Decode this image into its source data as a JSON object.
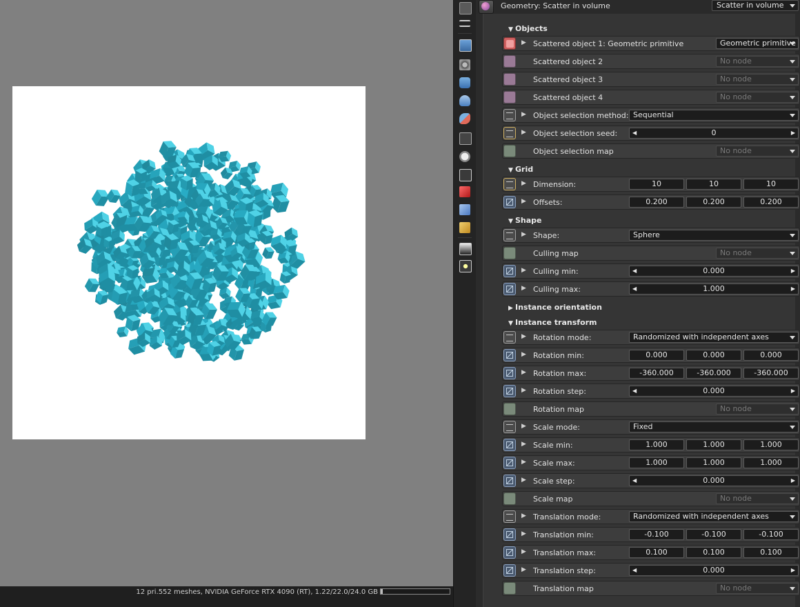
{
  "viewport": {
    "status": "12 pri.552 meshes, NVIDIA GeForce RTX 4090 (RT), 1.22/22.0/24.0 GB",
    "memory_fraction": 0.03,
    "render_background": "#ffffff",
    "cube_color": "#2ab5cf"
  },
  "panel": {
    "title": "Geometry: Scatter in volume",
    "type_value": "Scatter in volume"
  },
  "sections": {
    "objects": "Objects",
    "grid": "Grid",
    "shape": "Shape",
    "instance_orientation": "Instance orientation",
    "instance_transform": "Instance transform"
  },
  "rows": {
    "scattered1": {
      "label": "Scattered object 1: Geometric primitive",
      "value": "Geometric primitive"
    },
    "scattered2": {
      "label": "Scattered object 2",
      "value": "No node"
    },
    "scattered3": {
      "label": "Scattered object 3",
      "value": "No node"
    },
    "scattered4": {
      "label": "Scattered object 4",
      "value": "No node"
    },
    "sel_method": {
      "label": "Object selection method:",
      "value": "Sequential"
    },
    "sel_seed": {
      "label": "Object selection seed:",
      "value": "0"
    },
    "sel_map": {
      "label": "Object selection map",
      "value": "No node"
    },
    "dimension": {
      "label": "Dimension:",
      "values": [
        "10",
        "10",
        "10"
      ]
    },
    "offsets": {
      "label": "Offsets:",
      "values": [
        "0.200",
        "0.200",
        "0.200"
      ]
    },
    "shape": {
      "label": "Shape:",
      "value": "Sphere"
    },
    "culling_map": {
      "label": "Culling map",
      "value": "No node"
    },
    "culling_min": {
      "label": "Culling min:",
      "value": "0.000"
    },
    "culling_max": {
      "label": "Culling max:",
      "value": "1.000"
    },
    "rotation_mode": {
      "label": "Rotation mode:",
      "value": "Randomized with independent axes"
    },
    "rotation_min": {
      "label": "Rotation min:",
      "values": [
        "0.000",
        "0.000",
        "0.000"
      ]
    },
    "rotation_max": {
      "label": "Rotation max:",
      "values": [
        "-360.000",
        "-360.000",
        "-360.000"
      ]
    },
    "rotation_step": {
      "label": "Rotation step:",
      "value": "0.000"
    },
    "rotation_map": {
      "label": "Rotation map",
      "value": "No node"
    },
    "scale_mode": {
      "label": "Scale mode:",
      "value": "Fixed"
    },
    "scale_min": {
      "label": "Scale min:",
      "values": [
        "1.000",
        "1.000",
        "1.000"
      ]
    },
    "scale_max": {
      "label": "Scale max:",
      "values": [
        "1.000",
        "1.000",
        "1.000"
      ]
    },
    "scale_step": {
      "label": "Scale step:",
      "value": "0.000"
    },
    "scale_map": {
      "label": "Scale map",
      "value": "No node"
    },
    "translation_mode": {
      "label": "Translation mode:",
      "value": "Randomized with independent axes"
    },
    "translation_min": {
      "label": "Translation min:",
      "values": [
        "-0.100",
        "-0.100",
        "-0.100"
      ]
    },
    "translation_max": {
      "label": "Translation max:",
      "values": [
        "0.100",
        "0.100",
        "0.100"
      ]
    },
    "translation_step": {
      "label": "Translation step:",
      "value": "0.000"
    },
    "translation_map": {
      "label": "Translation map",
      "value": "No node"
    }
  },
  "toolbar_icons": [
    "window-icon",
    "list-icon",
    "image-icon",
    "camera-icon",
    "stack-icon",
    "teapot-icon",
    "material-icon",
    "film-icon",
    "clock-icon",
    "graph-icon",
    "red-cube-icon",
    "blue-cubes-icon",
    "yellow-cubes-icon",
    "environment-icon",
    "light-icon"
  ]
}
